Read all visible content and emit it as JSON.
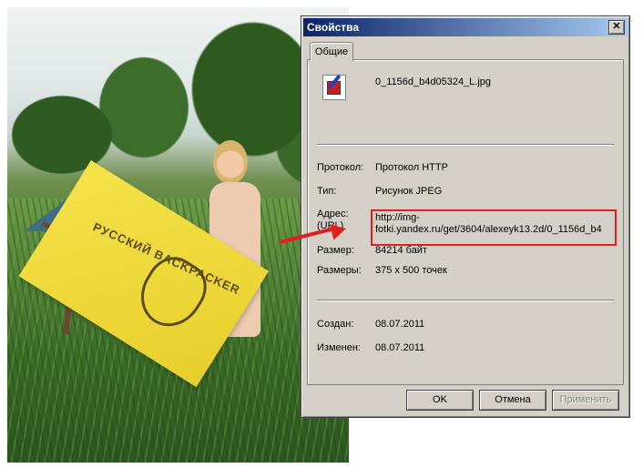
{
  "background_photo": {
    "flag_text": "РУССКИЙ BACKPACKER"
  },
  "dialog": {
    "title": "Свойства",
    "close_glyph": "✕",
    "tabs": [
      {
        "label": "Общие"
      }
    ],
    "file_name": "0_1156d_b4d05324_L.jpg",
    "icon": "image-file-icon",
    "properties": {
      "protocol_label": "Протокол:",
      "protocol_value": "Протокол HTTP",
      "type_label": "Тип:",
      "type_value": "Рисунок JPEG",
      "address_label": "Адрес:",
      "address_label_2": "(URL)",
      "address_value": "http://img-fotki.yandex.ru/get/3604/alexeyk13.2d/0_1156d_b4",
      "size_label": "Размер:",
      "size_value": "84214 байт",
      "dimensions_label": "Размеры:",
      "dimensions_value": "375 x 500 точек",
      "created_label": "Создан:",
      "created_value": "08.07.2011",
      "modified_label": "Изменен:",
      "modified_value": "08.07.2011"
    },
    "buttons": {
      "ok": "OK",
      "cancel": "Отмена",
      "apply": "Применить"
    },
    "annotation_color": "#e02020"
  }
}
